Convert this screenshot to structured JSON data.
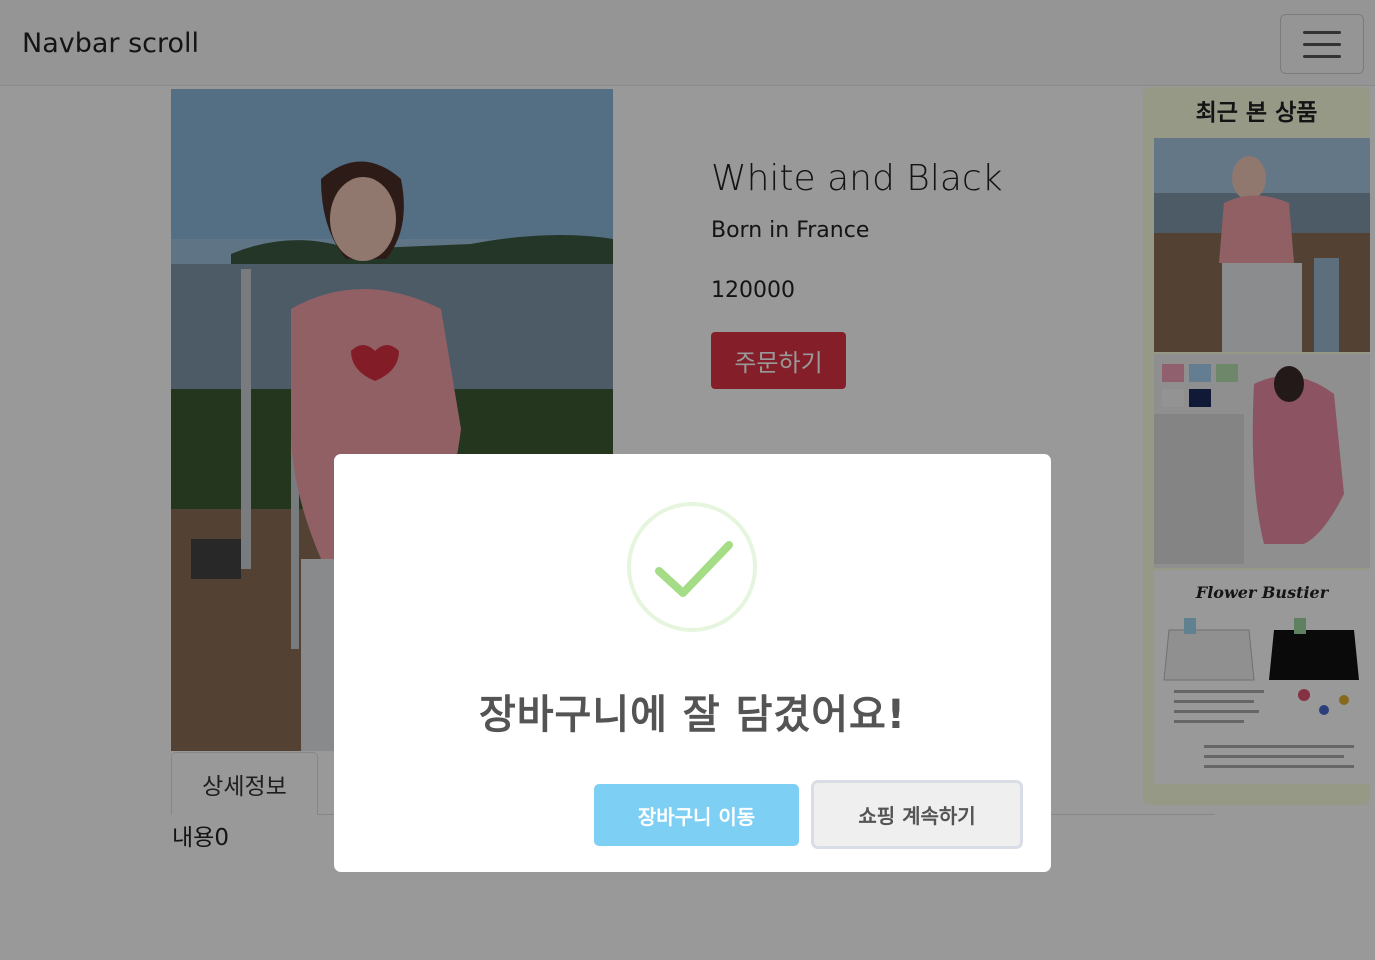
{
  "navbar": {
    "brand": "Navbar scroll",
    "toggler_icon": "hamburger-menu-icon"
  },
  "product": {
    "title": "White and Black",
    "subtitle": "Born in France",
    "price": "120000",
    "order_label": "주문하기"
  },
  "tabs": {
    "items": [
      {
        "label": "상세정보"
      }
    ],
    "content": "내용0"
  },
  "recent": {
    "title": "최근 본 상품",
    "thumb3_caption": "Flower Bustier"
  },
  "modal": {
    "title": "장바구니에 잘 담겼어요!",
    "confirm_label": "장바구니 이동",
    "cancel_label": "쇼핑 계속하기",
    "icon": "success-check-icon",
    "colors": {
      "confirm": "#7ecff4",
      "check": "#a5dc86",
      "order": "#dc3545"
    }
  }
}
